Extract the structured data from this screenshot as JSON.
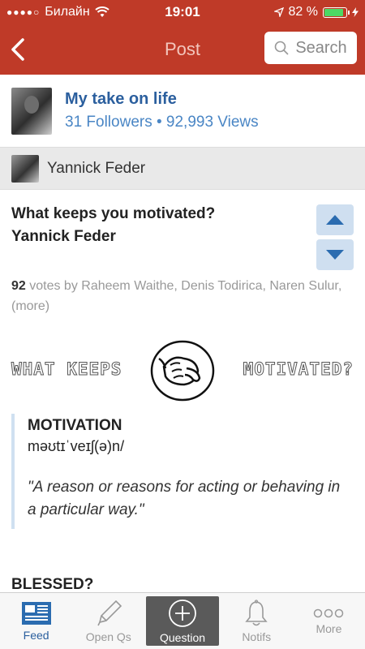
{
  "status": {
    "carrier": "Билайн",
    "time": "19:01",
    "battery": "82 %",
    "battery_level": 0.82
  },
  "nav": {
    "title": "Post",
    "search_label": "Search"
  },
  "blog": {
    "title": "My take on life",
    "meta": "31 Followers • 92,993 Views"
  },
  "author": {
    "name": "Yannick Feder"
  },
  "post": {
    "question_line1": "What keeps you motivated?",
    "question_line2": "Yannick Feder",
    "vote_count": "92",
    "votes_text": " votes by Raheem Waithe, Denis Todirica, Naren Sulur, (more)",
    "banner_left": "WHAT KEEPS",
    "banner_right": "MOTIVATED?",
    "definition": {
      "word": "MOTIVATION",
      "phonetic": "məʊtɪˈveɪʃ(ə)n/",
      "meaning": "\"A reason or reasons for acting or behaving in a particular way.\""
    },
    "next_section": "BLESSED?"
  },
  "tabs": [
    {
      "label": "Feed",
      "icon": "feed-icon"
    },
    {
      "label": "Open Qs",
      "icon": "pencil-icon"
    },
    {
      "label": "Question",
      "icon": "plus-circle-icon"
    },
    {
      "label": "Notifs",
      "icon": "bell-icon"
    },
    {
      "label": "More",
      "icon": "more-dots-icon"
    }
  ],
  "colors": {
    "header": "#bf3a28",
    "link": "#2b5f9e",
    "vote_bg": "#cfdff0",
    "vote_arrow": "#2b6cb0"
  }
}
